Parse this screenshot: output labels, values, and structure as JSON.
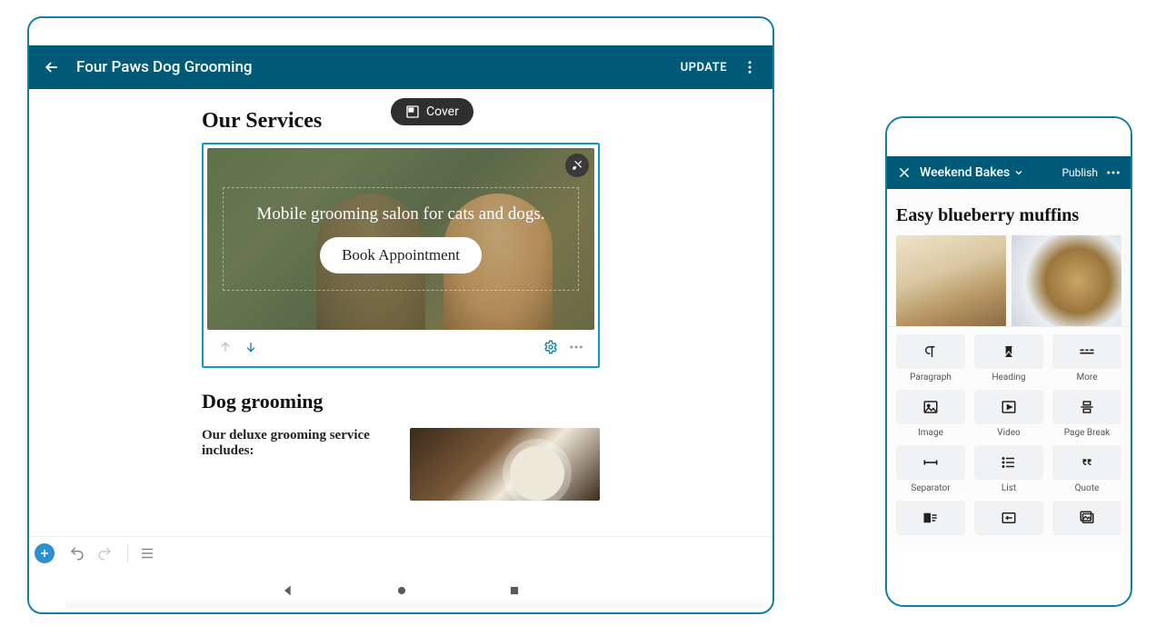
{
  "tablet": {
    "site_title": "Four Paws Dog Grooming",
    "update_label": "UPDATE",
    "tooltip_label": "Cover",
    "section_heading": "Our Services",
    "cover_text": "Mobile grooming salon for cats and dogs.",
    "book_button": "Book Appointment",
    "sub_heading": "Dog grooming",
    "paragraph": "Our deluxe grooming service includes:"
  },
  "phone": {
    "site_title": "Weekend Bakes",
    "publish_label": "Publish",
    "post_title": "Easy blueberry muffins",
    "blocks": {
      "r1c1": "Paragraph",
      "r1c2": "Heading",
      "r1c3": "More",
      "r2c1": "Image",
      "r2c2": "Video",
      "r2c3": "Page Break",
      "r3c1": "Separator",
      "r3c2": "List",
      "r3c3": "Quote"
    }
  }
}
